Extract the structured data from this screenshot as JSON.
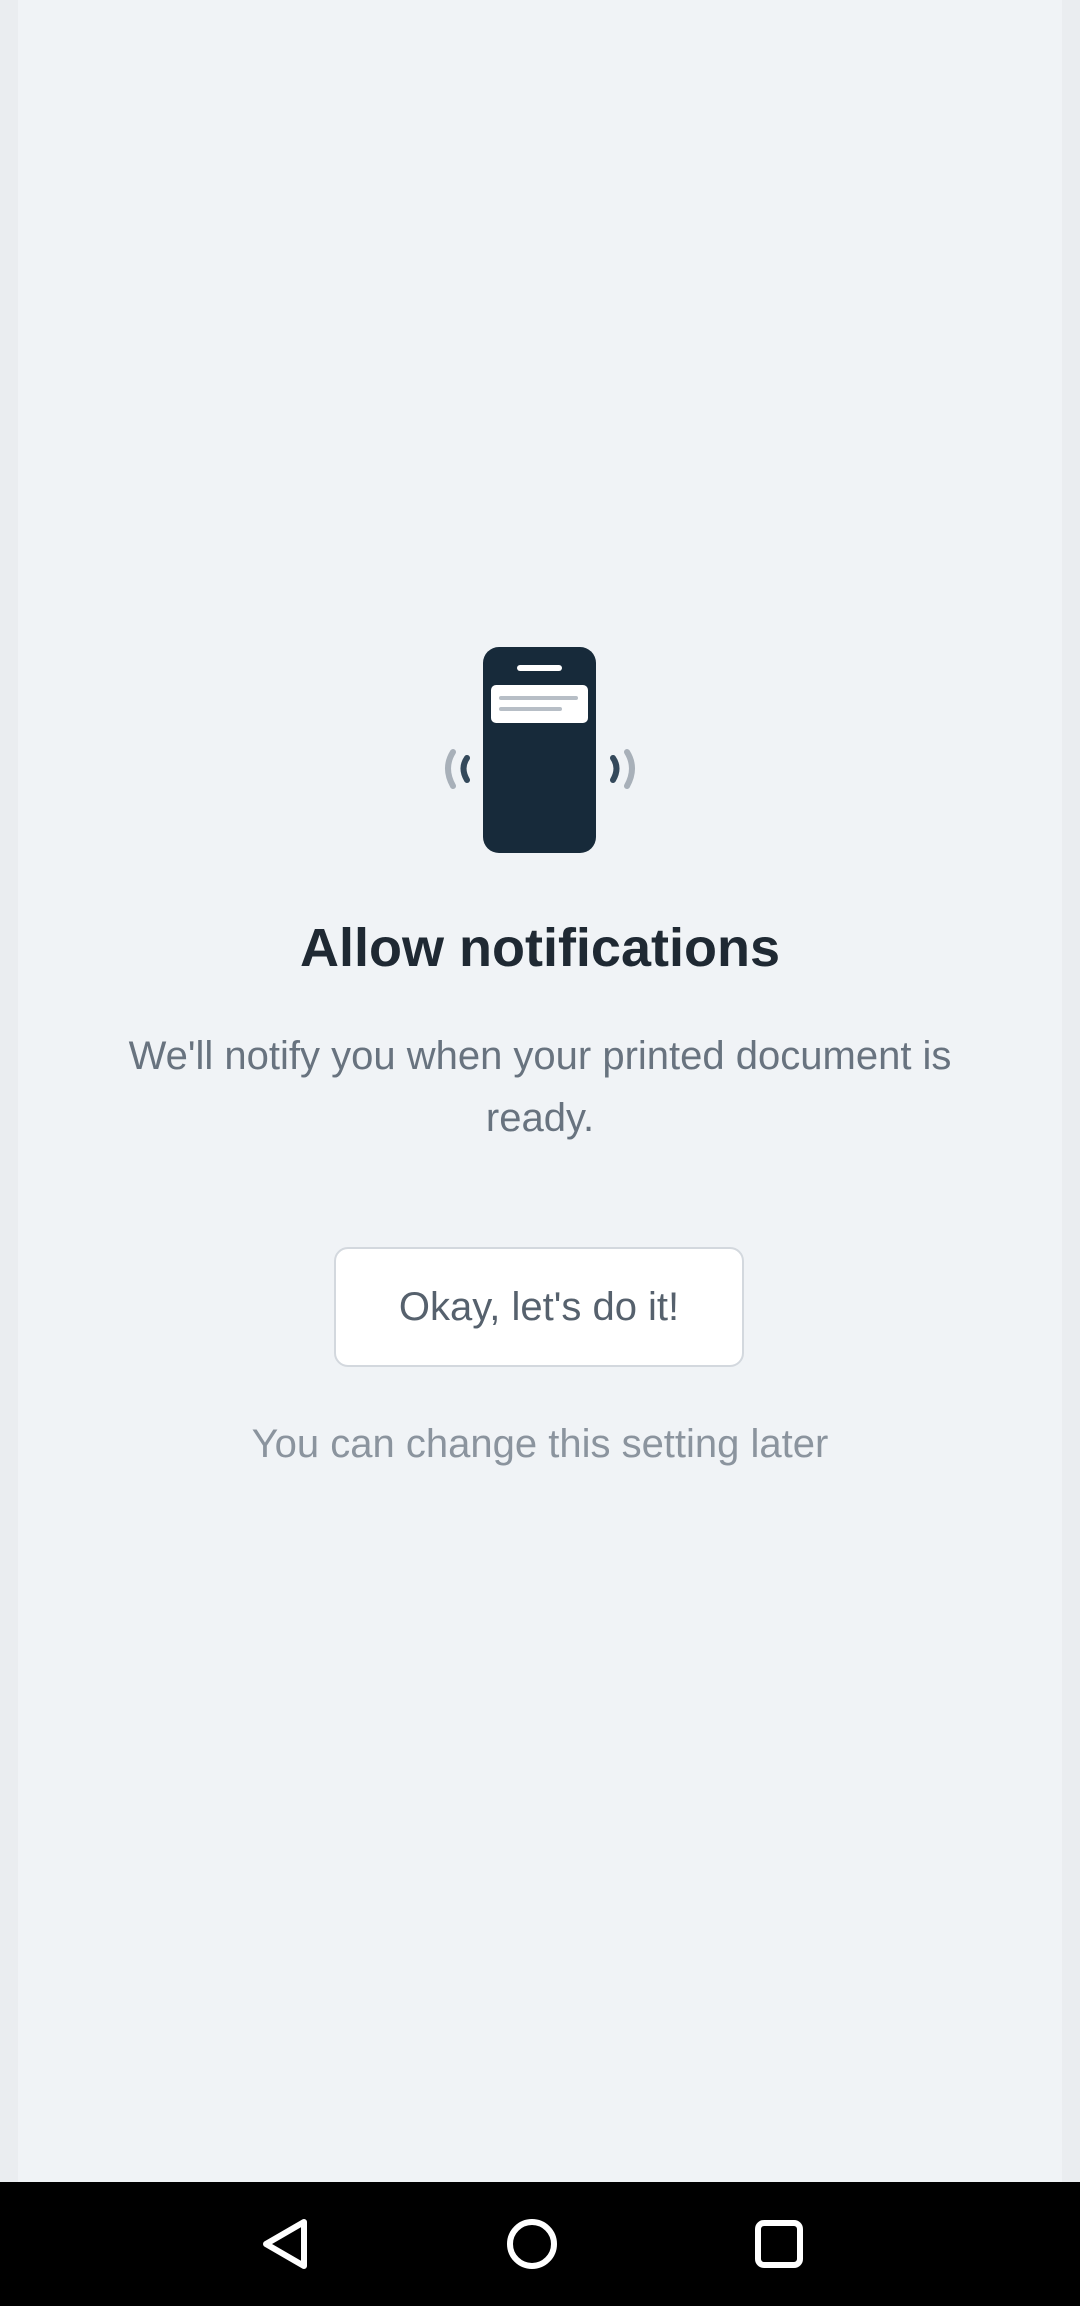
{
  "onboarding": {
    "title": "Allow notifications",
    "description": "We'll notify you when your printed document is ready.",
    "confirm_label": "Okay, let's do it!",
    "hint": "You can change this setting later",
    "illustration_icon": "phone-notification-icon"
  },
  "system_nav": {
    "back_icon": "back-triangle-icon",
    "home_icon": "home-circle-icon",
    "recents_icon": "recents-square-icon"
  },
  "colors": {
    "background": "#f0f3f6",
    "phone": "#172a3a",
    "title": "#1f2933",
    "body_text": "#68737f",
    "hint_text": "#8b949e",
    "nav_bar": "#000000"
  }
}
